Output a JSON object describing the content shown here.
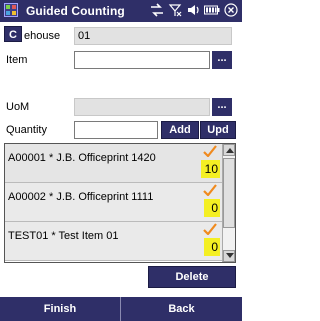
{
  "window": {
    "title": "Guided Counting"
  },
  "status": {
    "icons": [
      "connectivity-icon",
      "no-signal-icon",
      "volume-icon",
      "battery-icon",
      "close-icon"
    ]
  },
  "form": {
    "c_button_label": "C",
    "warehouse_label": "ehouse",
    "warehouse_value": "01",
    "item_label": "Item",
    "item_value": "",
    "item_lookup_label": "...",
    "uom_label": "UoM",
    "uom_value": "",
    "uom_lookup_label": "...",
    "quantity_label": "Quantity",
    "quantity_value": "",
    "add_label": "Add",
    "upd_label": "Upd"
  },
  "list": {
    "items": [
      {
        "text": "A00001 * J.B. Officeprint 1420",
        "qty": "10",
        "checked": true
      },
      {
        "text": "A00002 * J.B. Officeprint 1111",
        "qty": "0",
        "checked": true
      },
      {
        "text": "TEST01 * Test Item 01",
        "qty": "0",
        "checked": true
      }
    ]
  },
  "actions": {
    "delete_label": "Delete",
    "finish_label": "Finish",
    "back_label": "Back"
  },
  "colors": {
    "navy": "#2f2f68",
    "highlight": "#f4ef23",
    "check": "#f08a1e",
    "readonly": "#e2e2e2"
  }
}
